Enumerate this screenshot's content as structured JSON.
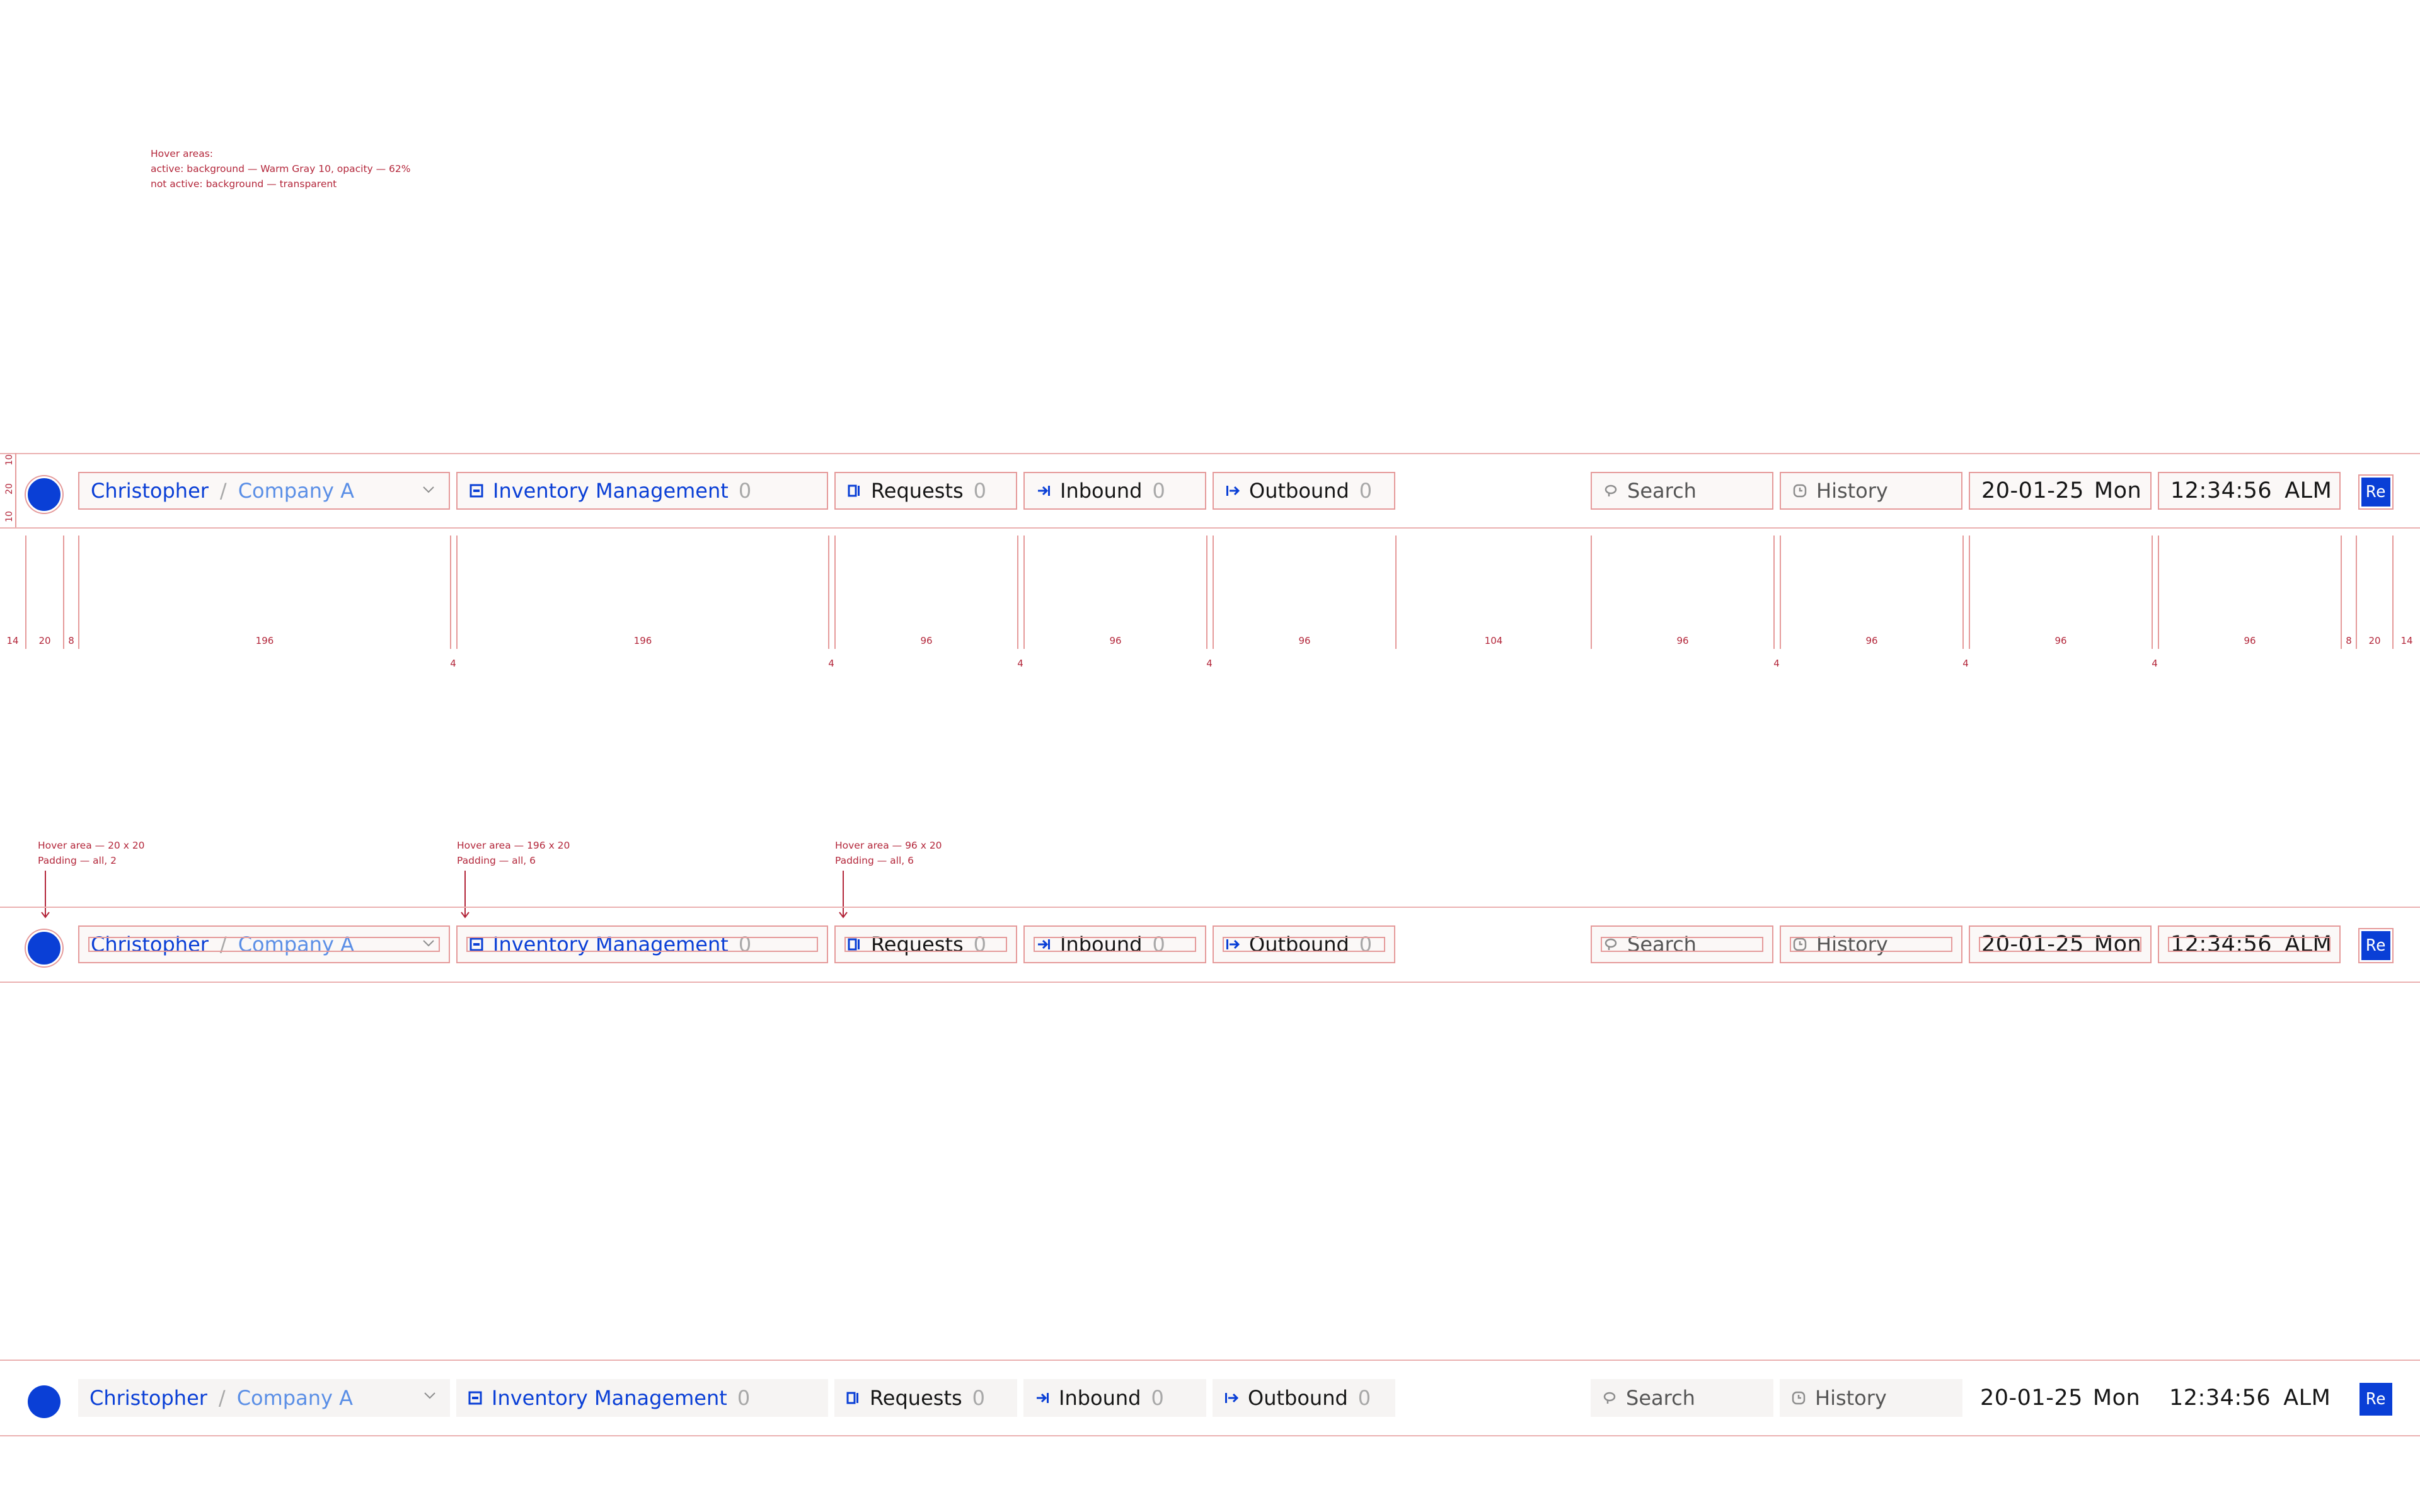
{
  "notes": {
    "hover_areas": {
      "title": "Hover areas:",
      "active": "active: background — Warm Gray 10, opacity — 62%",
      "inactive": "not active: background — transparent"
    },
    "avatar_hover": {
      "line1": "Hover area — 20 x 20",
      "line2": "Padding — all, 2"
    },
    "wide_hover": {
      "line1": "Hover area — 196 x 20",
      "line2": "Padding — all, 6"
    },
    "narrow_hover": {
      "line1": "Hover area — 96 x 20",
      "line2": "Padding — all, 6"
    }
  },
  "vertical_dims": [
    "10",
    "20",
    "10"
  ],
  "dims": {
    "widths": [
      "14",
      "20",
      "8",
      "196",
      "196",
      "96",
      "96",
      "96",
      "104",
      "96",
      "96",
      "96",
      "96",
      "8",
      "20",
      "14"
    ],
    "gaps": [
      "4",
      "4",
      "4",
      "4",
      "4",
      "4",
      "4",
      "4"
    ]
  },
  "navbar": {
    "user": "Christopher",
    "separator": "/",
    "company": "Company A",
    "inventory": {
      "label": "Inventory Management",
      "count": "0"
    },
    "requests": {
      "label": "Requests",
      "count": "0"
    },
    "inbound": {
      "label": "Inbound",
      "count": "0"
    },
    "outbound": {
      "label": "Outbound",
      "count": "0"
    },
    "search": "Search",
    "history": "History",
    "date": "20-01-25",
    "day": "Mon",
    "time": "12:34:56",
    "zone": "ALM",
    "logo": "Re"
  },
  "colors": {
    "accent": "#0a3fd6",
    "annotation": "#b3263a",
    "guide": "#e59a9a",
    "hover_bg": "#f6f4f3"
  }
}
